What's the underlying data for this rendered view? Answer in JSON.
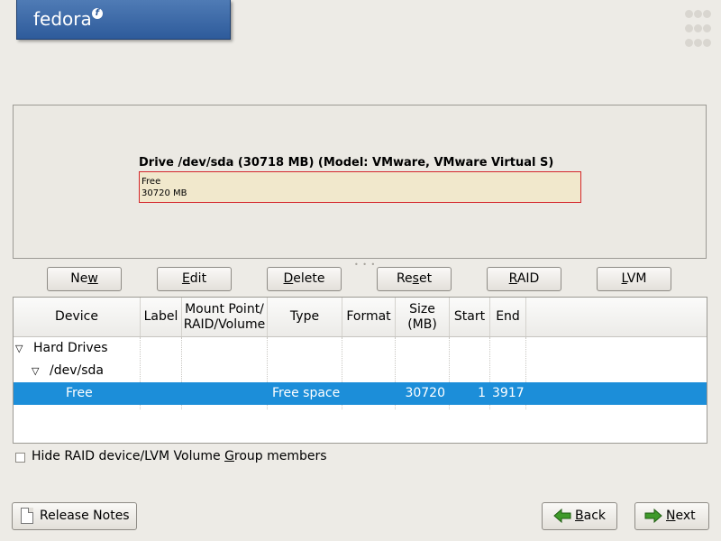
{
  "header": {
    "logo_text": "fedora",
    "logo_badge": "f"
  },
  "drive": {
    "title": "Drive /dev/sda (30718 MB) (Model: VMware, VMware Virtual S)",
    "segment_name": "Free",
    "segment_size": "30720 MB"
  },
  "buttons": {
    "new": {
      "pre": "Ne",
      "acc": "w",
      "post": ""
    },
    "edit": {
      "pre": "",
      "acc": "E",
      "post": "dit"
    },
    "delete": {
      "pre": "",
      "acc": "D",
      "post": "elete"
    },
    "reset": {
      "pre": "Re",
      "acc": "s",
      "post": "et"
    },
    "raid": {
      "pre": "",
      "acc": "R",
      "post": "AID"
    },
    "lvm": {
      "pre": "",
      "acc": "L",
      "post": "VM"
    }
  },
  "table": {
    "headers": {
      "device": "Device",
      "label": "Label",
      "mount_1": "Mount Point/",
      "mount_2": "RAID/Volume",
      "type": "Type",
      "format": "Format",
      "size_1": "Size",
      "size_2": "(MB)",
      "start": "Start",
      "end": "End"
    },
    "rows": {
      "hard_drives": "Hard Drives",
      "sda": "/dev/sda",
      "free": {
        "device": "Free",
        "type": "Free space",
        "size": "30720",
        "start": "1",
        "end": "3917"
      }
    }
  },
  "options": {
    "hide_pre": "Hide RAID device/LVM Volume ",
    "hide_acc": "G",
    "hide_post": "roup members"
  },
  "nav": {
    "release_pre": "",
    "release_acc": "R",
    "release_post": "elease Notes",
    "back_pre": "",
    "back_acc": "B",
    "back_post": "ack",
    "next_pre": "",
    "next_acc": "N",
    "next_post": "ext"
  },
  "colors": {
    "selection": "#1c8ed9",
    "segment_border": "#d4262b",
    "segment_fill": "#f1e8cc",
    "arrow_green": "#3f9a2a"
  }
}
